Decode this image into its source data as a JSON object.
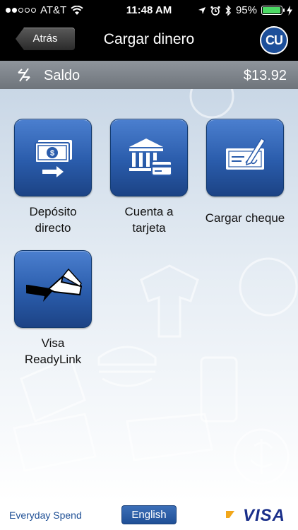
{
  "status_bar": {
    "carrier": "AT&T",
    "time": "11:48 AM",
    "battery": "95%",
    "battery_level": 0.95
  },
  "nav": {
    "back_label": "Atrás",
    "title": "Cargar dinero",
    "logo_text": "CU"
  },
  "balance": {
    "label": "Saldo",
    "value": "$13.92"
  },
  "tiles": [
    {
      "label": "Depósito directo",
      "line1": "Depósito",
      "line2": "directo",
      "icon": "direct-deposit-icon"
    },
    {
      "label": "Cuenta a tarjeta",
      "line1": "Cuenta a",
      "line2": "tarjeta",
      "icon": "bank-to-card-icon"
    },
    {
      "label": "Cargar cheque",
      "line1": "Cargar cheque",
      "icon": "check-icon"
    },
    {
      "label": "Visa ReadyLink",
      "line1": "Visa",
      "line2": "ReadyLink",
      "icon": "readylink-icon"
    }
  ],
  "footer": {
    "brand": "Everyday Spend",
    "language_button": "English",
    "visa_logo": "VISA"
  },
  "colors": {
    "tile_blue": "#2a5cab",
    "battery_green": "#4cd964",
    "brand_blue": "#1e4f95"
  }
}
